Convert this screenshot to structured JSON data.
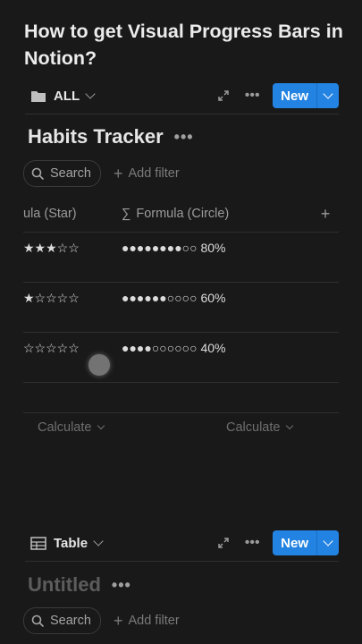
{
  "page": {
    "title": "How to get Visual Progress Bars in Notion?"
  },
  "top_view": {
    "tab_label": "ALL",
    "tab_icon": "folder-icon",
    "new_label": "New"
  },
  "habits": {
    "title": "Habits Tracker",
    "more": "•••",
    "search_label": "Search",
    "add_filter_label": "Add filter",
    "columns": {
      "star": "ula (Star)",
      "circle": "Formula (Circle)"
    },
    "rows": [
      {
        "star": "★★★☆☆",
        "circle": "●●●●●●●●○○ 80%"
      },
      {
        "star": "★☆☆☆☆",
        "circle": "●●●●●●○○○○ 60%"
      },
      {
        "star": "☆☆☆☆☆",
        "circle": "●●●●○○○○○○ 40%"
      }
    ],
    "calc_left": "Calculate",
    "calc_right": "Calculate"
  },
  "bottom_view": {
    "tab_label": "Table",
    "tab_icon": "table-icon",
    "new_label": "New"
  },
  "untitled": {
    "title": "Untitled",
    "more": "•••",
    "search_label": "Search",
    "add_filter_label": "Add filter"
  },
  "colors": {
    "accent": "#2383e2",
    "background": "#191919"
  }
}
